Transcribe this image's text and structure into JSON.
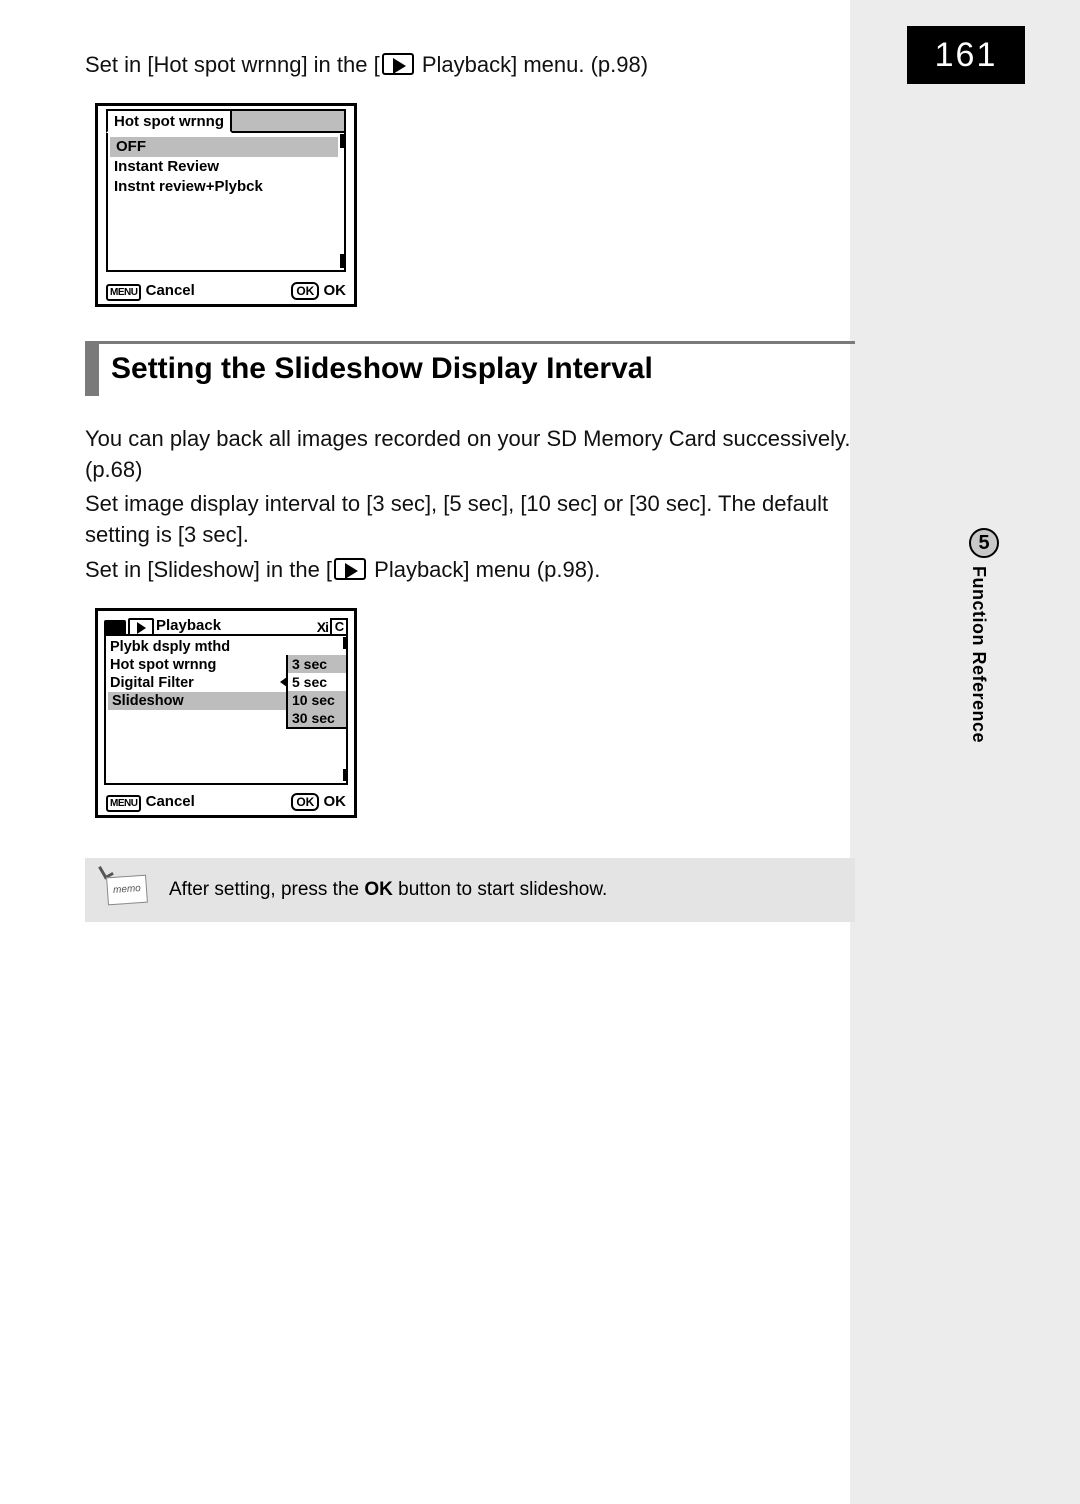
{
  "page_number": "161",
  "chapter": {
    "num": "5",
    "title": "Function Reference"
  },
  "intro_text_1a": "Set in [Hot spot wrnng] in the [",
  "intro_text_1b": " Playback] menu. (p.98)",
  "screen1": {
    "title": "Hot spot wrnng",
    "options": [
      "OFF",
      "Instant Review",
      "Instnt review+Plybck"
    ],
    "selected_index": 0,
    "menu_btn": "MENU",
    "cancel": "Cancel",
    "ok_btn": "OK",
    "ok": "OK"
  },
  "section_heading": "Setting the Slideshow Display Interval",
  "para2_line1": "You can play back all images recorded on your SD Memory Card successively. (p.68)",
  "para2_line2": "Set image display interval to [3 sec], [5 sec], [10 sec] or [30 sec]. The default setting is [3 sec].",
  "para2_line3a": "Set in [Slideshow] in the [",
  "para2_line3b": " Playback] menu (p.98).",
  "screen2": {
    "tab_label": "Playback",
    "tab_right_icons": "Xi",
    "tab_right_c": "C",
    "rows": [
      "Plybk dsply mthd",
      "Hot spot wrnng",
      "Digital Filter",
      "Slideshow"
    ],
    "selected_row": 3,
    "options": [
      "3 sec",
      "5 sec",
      "10 sec",
      "30 sec"
    ],
    "selected_option": 1,
    "menu_btn": "MENU",
    "cancel": "Cancel",
    "ok_btn": "OK",
    "ok": "OK"
  },
  "memo": {
    "label": "memo",
    "text_a": "After setting, press the ",
    "text_bold": "OK",
    "text_b": " button to start slideshow."
  }
}
